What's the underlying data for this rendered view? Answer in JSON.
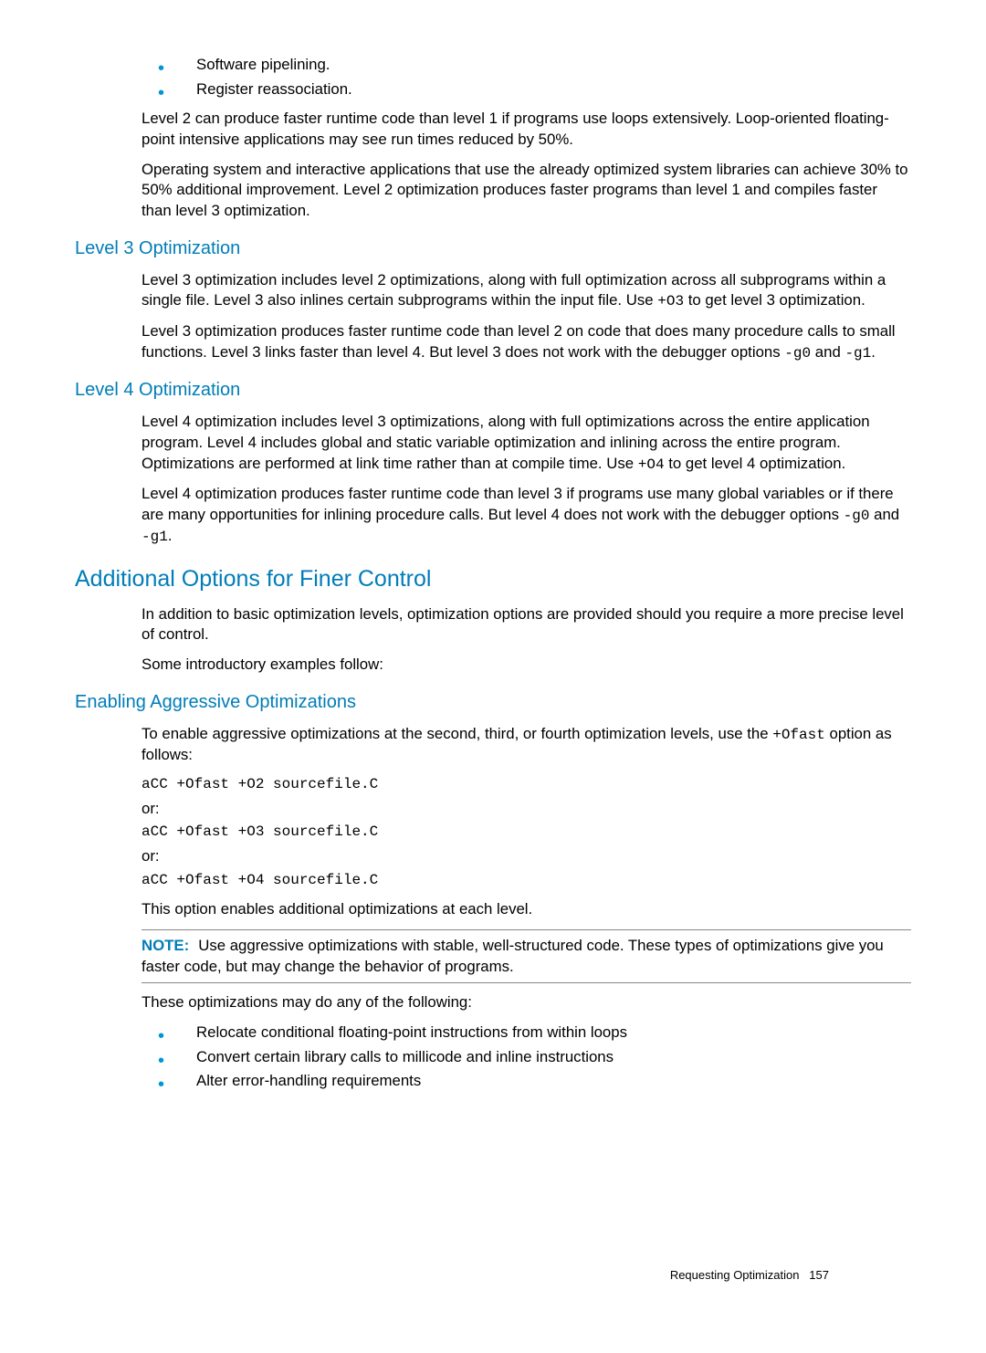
{
  "topList": [
    "Software pipelining.",
    "Register reassociation."
  ],
  "level2": {
    "p1": "Level 2 can produce faster runtime code than level 1 if programs use loops extensively. Loop-oriented floating-point intensive applications may see run times reduced by 50%.",
    "p2": "Operating system and interactive applications that use the already optimized system libraries can achieve 30% to 50% additional improvement. Level 2 optimization produces faster programs than level 1 and compiles faster than level 3 optimization."
  },
  "level3": {
    "heading": "Level 3 Optimization",
    "p1a": "Level 3 optimization includes level 2 optimizations, along with full optimization across all subprograms within a single file. Level 3 also inlines certain subprograms within the input file. Use ",
    "c1": "+O3",
    "p1b": " to get level 3 optimization.",
    "p2a": "Level 3 optimization produces faster runtime code than level 2 on code that does many procedure calls to small functions. Level 3 links faster than level 4. But level 3 does not work with the debugger options ",
    "c2": "-g0",
    "and": " and ",
    "c3": "-g1",
    "period": "."
  },
  "level4": {
    "heading": "Level 4 Optimization",
    "p1a": "Level 4 optimization includes level 3 optimizations, along with full optimizations across the entire application program. Level 4 includes global and static variable optimization and inlining across the entire program. Optimizations are performed at link time rather than at compile time. Use ",
    "c1": "+O4",
    "p1b": " to get level 4 optimization.",
    "p2a": "Level 4 optimization produces faster runtime code than level 3 if programs use many global variables or if there are many opportunities for inlining procedure calls. But level 4 does not work with the debugger options ",
    "c2": "-g0",
    "and": " and ",
    "c3": "-g1",
    "period": "."
  },
  "finer": {
    "heading": "Additional Options for Finer Control",
    "p1": "In addition to basic optimization levels, optimization options are provided should you require a more precise level of control.",
    "p2": "Some introductory examples follow:"
  },
  "aggressive": {
    "heading": "Enabling Aggressive Optimizations",
    "p1a": "To enable aggressive optimizations at the second, third, or fourth optimization levels, use the ",
    "c1": "+Ofast",
    "p1b": " option as follows:",
    "code1": "aCC +Ofast +O2 sourcefile.C",
    "or1": "or:",
    "code2": "aCC +Ofast +O3 sourcefile.C",
    "or2": "or:",
    "code3": "aCC +Ofast +O4 sourcefile.C",
    "p2": "This option enables additional optimizations at each level.",
    "noteLabel": "NOTE:",
    "noteText": "Use aggressive optimizations with stable, well-structured code. These types of optimizations give you faster code, but may change the behavior of programs.",
    "p3": "These optimizations may do any of the following:",
    "bullets": [
      "Relocate conditional floating-point instructions from within loops",
      "Convert certain library calls to millicode and inline instructions",
      "Alter error-handling requirements"
    ]
  },
  "footer": {
    "section": "Requesting Optimization",
    "page": "157"
  }
}
